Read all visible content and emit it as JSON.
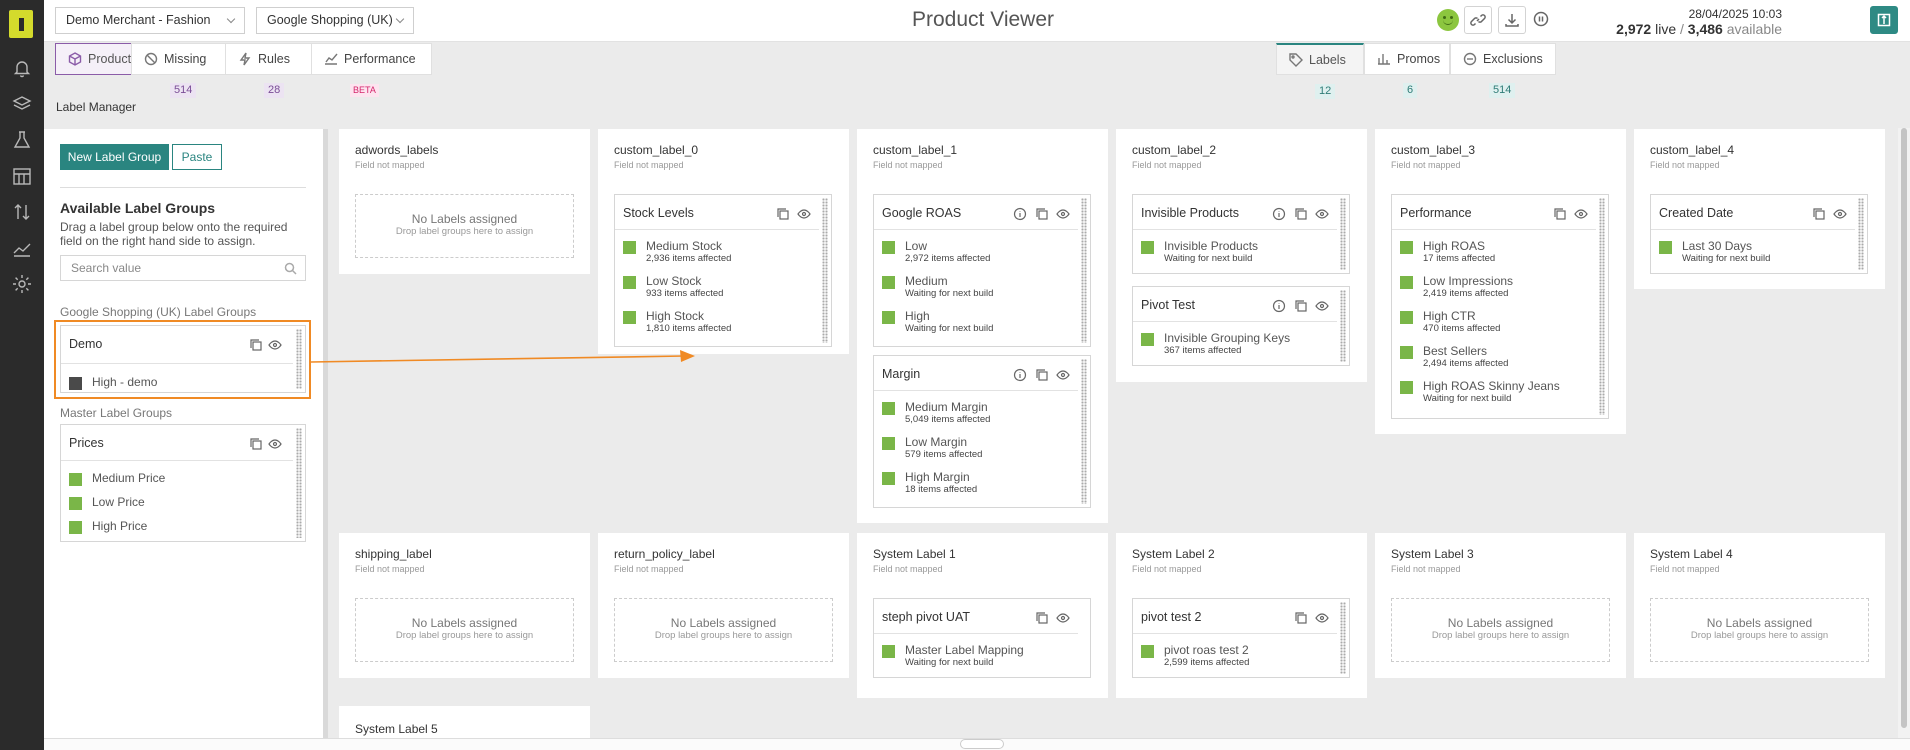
{
  "merchant_select": "Demo Merchant - Fashion",
  "channel_select": "Google Shopping (UK)",
  "page_title": "Product Viewer",
  "timestamp": "28/04/2025 10:03",
  "stats": {
    "live": "2,972",
    "live_label": "live",
    "sep": "/",
    "available": "3,486",
    "available_label": "available"
  },
  "toolbar_icons": [
    "smiley-icon",
    "link-icon",
    "download-icon",
    "pause-icon",
    "sync-icon"
  ],
  "tabs_left": [
    {
      "label": "Products",
      "icon": "box-icon",
      "badge": ""
    },
    {
      "label": "Missing",
      "icon": "block-icon",
      "badge": "514"
    },
    {
      "label": "Rules",
      "icon": "lightning-icon",
      "badge": "28"
    },
    {
      "label": "Performance",
      "icon": "chart-icon",
      "badge": "BETA"
    }
  ],
  "tabs_right": [
    {
      "label": "Labels",
      "icon": "tag-icon",
      "badge": "12"
    },
    {
      "label": "Promos",
      "icon": "bar-icon",
      "badge": "6"
    },
    {
      "label": "Exclusions",
      "icon": "minus-circle-icon",
      "badge": "514"
    }
  ],
  "label_manager_title": "Label Manager",
  "left_panel": {
    "new_button": "New Label Group",
    "paste_button": "Paste",
    "heading": "Available Label Groups",
    "help": "Drag a label group below onto the required field on the right hand side to assign.",
    "search_placeholder": "Search value",
    "section_channel": "Google Shopping (UK) Label Groups",
    "section_master": "Master Label Groups",
    "demo_group": {
      "name": "Demo",
      "label": "High - demo"
    },
    "prices_group": {
      "name": "Prices",
      "labels": [
        "Medium Price",
        "Low Price",
        "High Price"
      ]
    }
  },
  "common": {
    "field_not_mapped": "Field not mapped",
    "no_labels": "No Labels assigned",
    "drop_hint": "Drop label groups here to assign"
  },
  "fields": {
    "adwords": "adwords_labels",
    "c0": "custom_label_0",
    "c1": "custom_label_1",
    "c2": "custom_label_2",
    "c3": "custom_label_3",
    "c4": "custom_label_4",
    "shipping": "shipping_label",
    "return": "return_policy_label",
    "s1": "System Label 1",
    "s2": "System Label 2",
    "s3": "System Label 3",
    "s4": "System Label 4",
    "s5": "System Label 5"
  },
  "groups": {
    "stock": {
      "name": "Stock Levels",
      "labels": [
        {
          "name": "Medium Stock",
          "sub": "2,936 items affected"
        },
        {
          "name": "Low Stock",
          "sub": "933 items affected"
        },
        {
          "name": "High Stock",
          "sub": "1,810 items affected"
        }
      ]
    },
    "roas": {
      "name": "Google ROAS",
      "labels": [
        {
          "name": "Low",
          "sub": "2,972 items affected"
        },
        {
          "name": "Medium",
          "sub": "Waiting for next build"
        },
        {
          "name": "High",
          "sub": "Waiting for next build"
        }
      ]
    },
    "margin": {
      "name": "Margin",
      "labels": [
        {
          "name": "Medium Margin",
          "sub": "5,049 items affected"
        },
        {
          "name": "Low Margin",
          "sub": "579 items affected"
        },
        {
          "name": "High Margin",
          "sub": "18 items affected"
        }
      ]
    },
    "invisible": {
      "name": "Invisible Products",
      "labels": [
        {
          "name": "Invisible Products",
          "sub": "Waiting for next build"
        }
      ]
    },
    "pivot": {
      "name": "Pivot Test",
      "labels": [
        {
          "name": "Invisible Grouping Keys",
          "sub": "367 items affected"
        }
      ]
    },
    "performance": {
      "name": "Performance",
      "labels": [
        {
          "name": "High ROAS",
          "sub": "17 items affected"
        },
        {
          "name": "Low Impressions",
          "sub": "2,419 items affected"
        },
        {
          "name": "High CTR",
          "sub": "470 items affected"
        },
        {
          "name": "Best Sellers",
          "sub": "2,494 items affected"
        },
        {
          "name": "High ROAS Skinny Jeans",
          "sub": "Waiting for next build"
        }
      ]
    },
    "created": {
      "name": "Created Date",
      "labels": [
        {
          "name": "Last 30 Days",
          "sub": "Waiting for next build"
        }
      ]
    },
    "steph": {
      "name": "steph pivot UAT",
      "labels": [
        {
          "name": "Master Label Mapping",
          "sub": "Waiting for next build"
        }
      ]
    },
    "pivot2": {
      "name": "pivot test 2",
      "labels": [
        {
          "name": "pivot roas test 2",
          "sub": "2,599 items affected"
        }
      ]
    }
  },
  "colors": {
    "accent": "#2a8580",
    "label_green": "#7ab648",
    "tab_purple": "#8b5ca8",
    "highlight": "#f08a24"
  }
}
